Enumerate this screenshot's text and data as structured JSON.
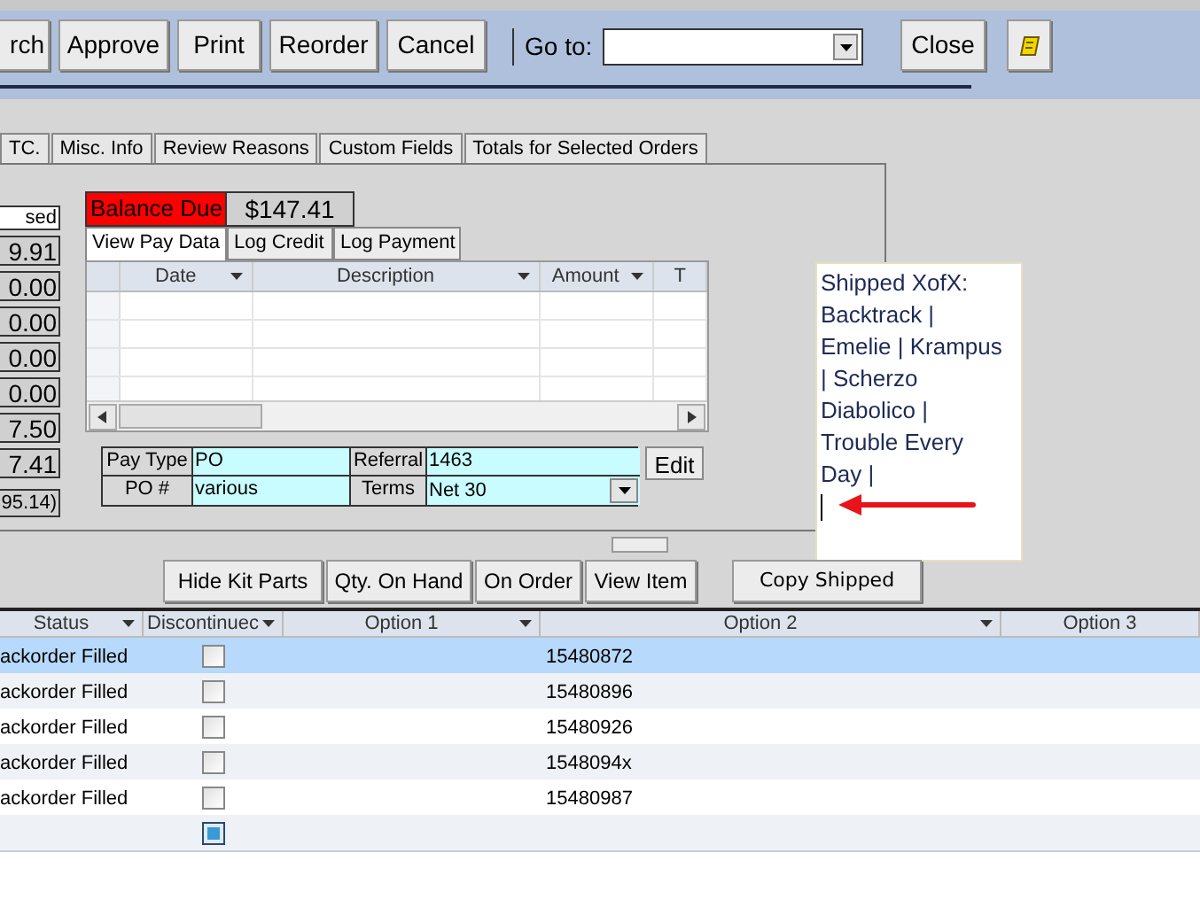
{
  "toolbar": {
    "buttons": [
      {
        "label": "rch"
      },
      {
        "label": "Approve"
      },
      {
        "label": "Print"
      },
      {
        "label": "Reorder"
      },
      {
        "label": "Cancel"
      }
    ],
    "goto": {
      "label": "Go to:"
    },
    "close": {
      "label": "Close"
    }
  },
  "tabs": [
    {
      "label": "TC.",
      "selected": false
    },
    {
      "label": "Misc. Info",
      "selected": false
    },
    {
      "label": "Review Reasons",
      "selected": false
    },
    {
      "label": "Custom Fields",
      "selected": false
    },
    {
      "label": "Totals for Selected Orders",
      "selected": false
    }
  ],
  "totals": {
    "header": "sed",
    "values": [
      "9.91",
      "0.00",
      "0.00",
      "0.00",
      "0.00",
      "7.50",
      "7.41"
    ],
    "footer": "95.14)"
  },
  "balance": {
    "label": "Balance Due",
    "value": "$147.41"
  },
  "pay_tabs": [
    {
      "label": "View Pay Data",
      "selected": true
    },
    {
      "label": "Log Credit",
      "selected": false
    },
    {
      "label": "Log Payment",
      "selected": false
    }
  ],
  "pay_grid": {
    "columns": [
      "Date",
      "Description",
      "Amount",
      "T"
    ]
  },
  "pay_fields": {
    "pay_type_label": "Pay Type",
    "pay_type": "PO",
    "referral_label": "Referral",
    "referral": "1463",
    "po_label": "PO #",
    "po": "various",
    "terms_label": "Terms",
    "terms": "Net 30",
    "edit": "Edit"
  },
  "note": {
    "value": "Shipped XofX: Backtrack | Emelie | Krampus | Scherzo Diabolico | Trouble Every Day |"
  },
  "actions": [
    "Hide Kit Parts",
    "Qty. On Hand",
    "On Order",
    "View Item"
  ],
  "copy_shipped": "Copy Shipped",
  "items": {
    "columns": [
      "Status",
      "Discontinuec",
      "Option 1",
      "Option 2",
      "Option 3"
    ],
    "rows": [
      {
        "kind": "item",
        "status": "ackorder Filled",
        "discontinued": false,
        "option_2": "15480872",
        "selected": true
      },
      {
        "kind": "item",
        "status": "ackorder Filled",
        "discontinued": false,
        "option_2": "15480896",
        "selected": false
      },
      {
        "kind": "item",
        "status": "ackorder Filled",
        "discontinued": false,
        "option_2": "15480926",
        "selected": false
      },
      {
        "kind": "item",
        "status": "ackorder Filled",
        "discontinued": false,
        "option_2": "1548094x",
        "selected": false
      },
      {
        "kind": "item",
        "status": "ackorder Filled",
        "discontinued": false,
        "option_2": "15480987",
        "selected": false
      },
      {
        "kind": "new",
        "discontinued": false,
        "selected": false
      }
    ]
  }
}
